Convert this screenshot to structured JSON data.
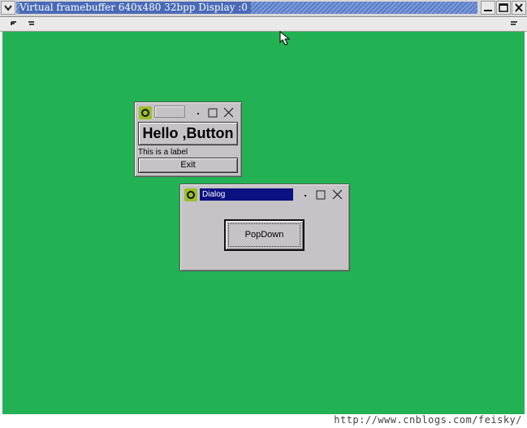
{
  "host": {
    "title": "Virtual framebuffer 640x480 32bpp Display :0",
    "watermark": "http://www.cnblogs.com/feisky/"
  },
  "hello_window": {
    "title": "",
    "button_label": "Hello ,Button",
    "label_text": "This is a label",
    "exit_label": "Exit"
  },
  "dialog_window": {
    "title": "Dialog",
    "popdown_label": "PopDown"
  },
  "colors": {
    "desktop": "#22b153",
    "dialog_title_bg": "#0a1180",
    "window_bg": "#c6c3c6"
  }
}
